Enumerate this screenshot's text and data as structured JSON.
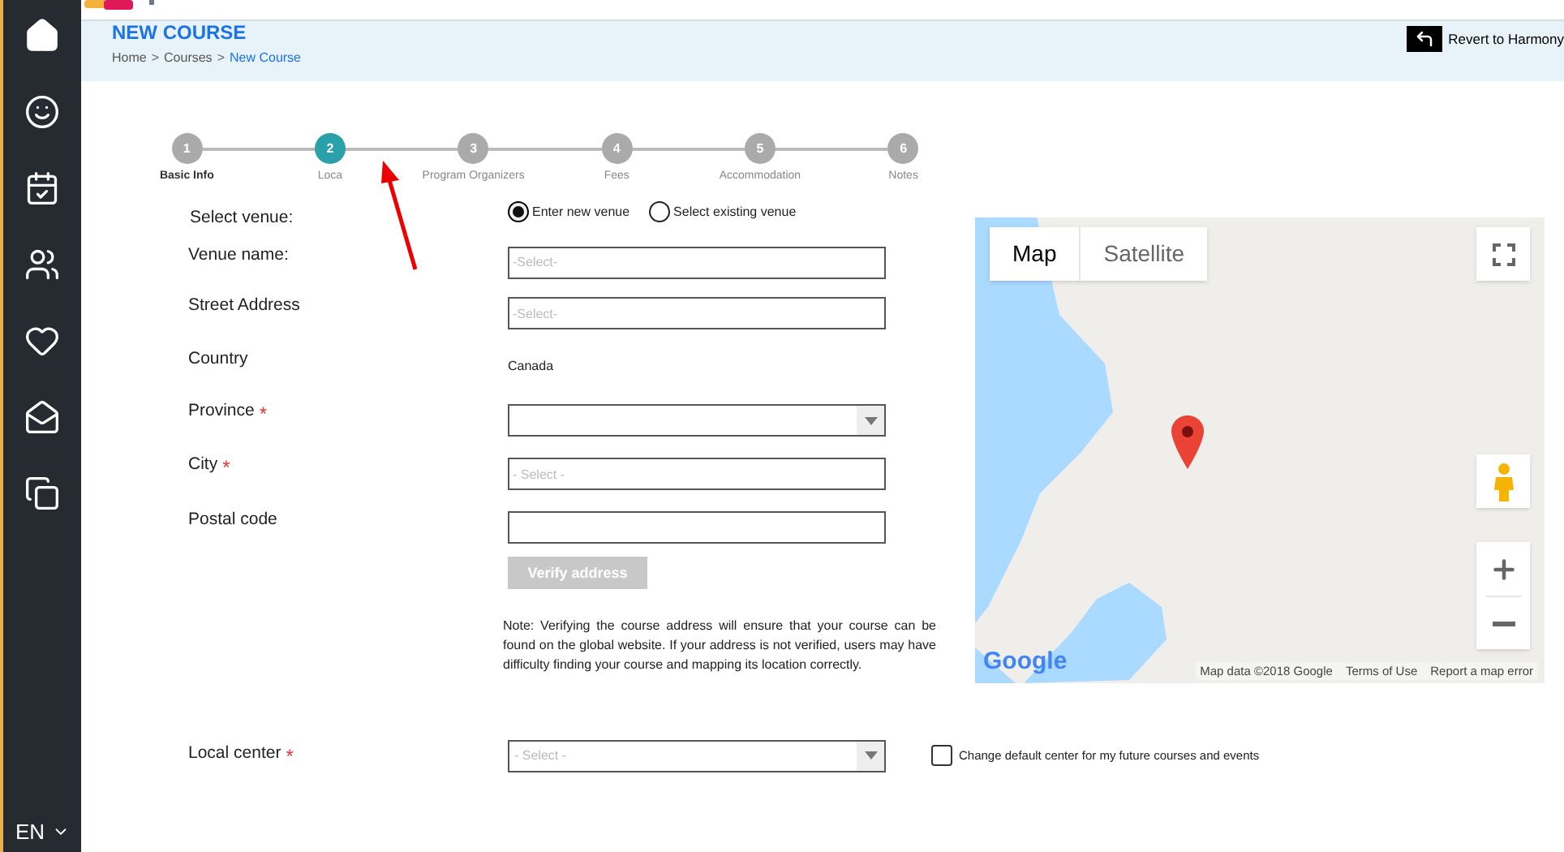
{
  "header": {
    "title": "NEW COURSE",
    "breadcrumb": [
      {
        "label": "Home",
        "current": false
      },
      {
        "label": "Courses",
        "current": false
      },
      {
        "label": "New Course",
        "current": true
      }
    ],
    "separator": ">",
    "revert_button": "Revert to Harmony"
  },
  "sidebar": {
    "language": "EN"
  },
  "required_mark": "*",
  "steps": [
    {
      "number": "1",
      "label": "Basic Info",
      "selected": false
    },
    {
      "number": "2",
      "label": "Loca",
      "selected": true
    },
    {
      "number": "3",
      "label": "Program Organizers",
      "selected": false
    },
    {
      "number": "4",
      "label": "Fees",
      "selected": false
    },
    {
      "number": "5",
      "label": "Accommodation",
      "selected": false
    },
    {
      "number": "6",
      "label": "Notes",
      "selected": false
    }
  ],
  "venue": {
    "label": "Select venue:",
    "options": [
      {
        "label": "Enter new venue",
        "selected": true
      },
      {
        "label": "Select existing venue",
        "selected": false
      }
    ]
  },
  "fields": [
    {
      "kind": "input",
      "label": "Venue name:",
      "required": false,
      "placeholder": "-Select-"
    },
    {
      "kind": "input",
      "label": "Street Address",
      "required": false,
      "placeholder": "-Select-"
    },
    {
      "kind": "text",
      "label": "Country",
      "required": false,
      "value": "Canada"
    },
    {
      "kind": "select",
      "label": "Province",
      "required": true
    },
    {
      "kind": "input",
      "label": "City",
      "required": true,
      "placeholder": "- Select -"
    },
    {
      "kind": "input",
      "label": "Postal code",
      "required": false
    }
  ],
  "verify_button": {
    "label": "Verify address",
    "disabled": true
  },
  "note": "Note: Verifying the course address will ensure that your course can be found on the global website. If your address is not verified, users may have difficulty finding your course and mapping its location correctly.",
  "local_center": {
    "label": "Local center",
    "required": true,
    "placeholder": "- Select -",
    "checkbox": {
      "label": "Change default center for my future courses and events",
      "checked": false
    }
  },
  "map": {
    "tabs": [
      {
        "label": "Map",
        "selected": true
      },
      {
        "label": "Satellite",
        "selected": false
      }
    ],
    "logo": "Google",
    "footer": [
      "Map data ©2018 Google",
      "Terms of Use",
      "Report a map error"
    ]
  }
}
